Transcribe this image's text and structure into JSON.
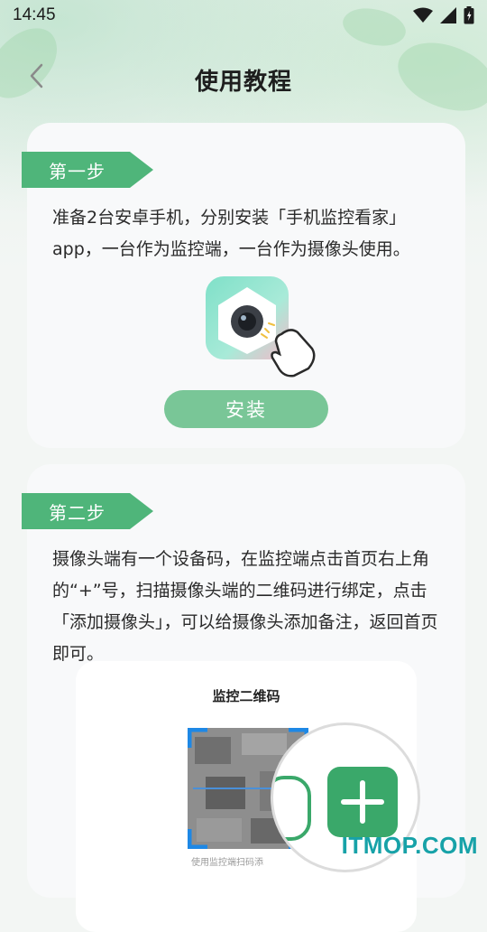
{
  "status_bar": {
    "time": "14:45"
  },
  "header": {
    "title": "使用教程"
  },
  "step1": {
    "tag": "第一步",
    "description": "准备2台安卓手机，分别安装「手机监控看家」app，一台作为监控端，一台作为摄像头使用。",
    "install_label": "安装"
  },
  "step2": {
    "tag": "第二步",
    "description": "摄像头端有一个设备码，在监控端点击首页右上角的“+”号，扫描摄像头端的二维码进行绑定，点击「添加摄像头」，可以给摄像头添加备注，返回首页即可。",
    "qr_title": "监控二维码",
    "qr_caption": "使用监控端扫码添"
  },
  "watermark": "ITMOP.COM",
  "colors": {
    "accent_green": "#4fb57a",
    "button_green": "#79c697",
    "plus_green": "#3aa86a",
    "watermark": "#17a2a8"
  },
  "icons": {
    "back": "chevron-left-icon",
    "wifi": "wifi-icon",
    "signal": "signal-icon",
    "battery": "battery-icon"
  }
}
